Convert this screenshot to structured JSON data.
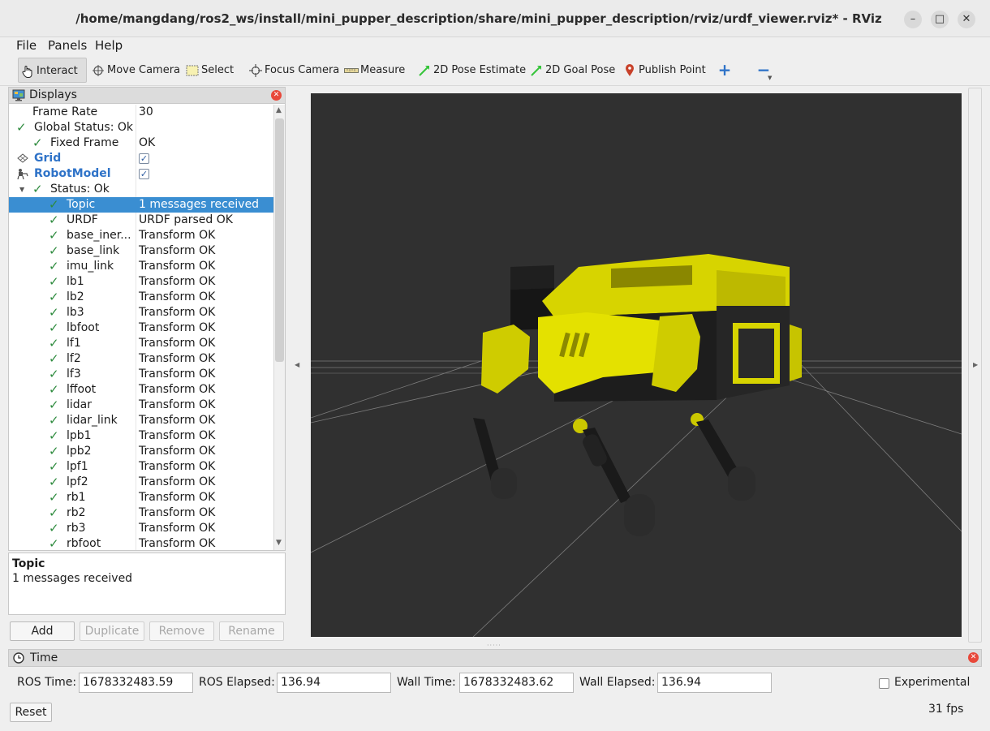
{
  "window": {
    "title": "/home/mangdang/ros2_ws/install/mini_pupper_description/share/mini_pupper_description/rviz/urdf_viewer.rviz* - RViz",
    "minimize": "–",
    "maximize": "□",
    "close": "✕"
  },
  "menu": [
    "File",
    "Panels",
    "Help"
  ],
  "toolbar": {
    "interact": "Interact",
    "move_camera": "Move Camera",
    "select": "Select",
    "focus_camera": "Focus Camera",
    "measure": "Measure",
    "pose_estimate": "2D Pose Estimate",
    "goal_pose": "2D Goal Pose",
    "publish_point": "Publish Point",
    "plus": "+",
    "minus": "−"
  },
  "displays": {
    "title": "Displays",
    "rows": [
      {
        "name": "Frame Rate",
        "value": "30"
      },
      {
        "name": "Global Status: Ok",
        "value": ""
      },
      {
        "name": "Fixed Frame",
        "value": "OK"
      },
      {
        "name": "Grid",
        "value": ""
      },
      {
        "name": "RobotModel",
        "value": ""
      },
      {
        "name": "Status: Ok",
        "value": ""
      },
      {
        "name": "Topic",
        "value": "1 messages received"
      },
      {
        "name": "URDF",
        "value": "URDF parsed OK"
      },
      {
        "name": "base_iner...",
        "value": "Transform OK"
      },
      {
        "name": "base_link",
        "value": "Transform OK"
      },
      {
        "name": "imu_link",
        "value": "Transform OK"
      },
      {
        "name": "lb1",
        "value": "Transform OK"
      },
      {
        "name": "lb2",
        "value": "Transform OK"
      },
      {
        "name": "lb3",
        "value": "Transform OK"
      },
      {
        "name": "lbfoot",
        "value": "Transform OK"
      },
      {
        "name": "lf1",
        "value": "Transform OK"
      },
      {
        "name": "lf2",
        "value": "Transform OK"
      },
      {
        "name": "lf3",
        "value": "Transform OK"
      },
      {
        "name": "lffoot",
        "value": "Transform OK"
      },
      {
        "name": "lidar",
        "value": "Transform OK"
      },
      {
        "name": "lidar_link",
        "value": "Transform OK"
      },
      {
        "name": "lpb1",
        "value": "Transform OK"
      },
      {
        "name": "lpb2",
        "value": "Transform OK"
      },
      {
        "name": "lpf1",
        "value": "Transform OK"
      },
      {
        "name": "lpf2",
        "value": "Transform OK"
      },
      {
        "name": "rb1",
        "value": "Transform OK"
      },
      {
        "name": "rb2",
        "value": "Transform OK"
      },
      {
        "name": "rb3",
        "value": "Transform OK"
      },
      {
        "name": "rbfoot",
        "value": "Transform OK"
      }
    ]
  },
  "description": {
    "title": "Topic",
    "text": "1 messages received"
  },
  "buttons": {
    "add": "Add",
    "duplicate": "Duplicate",
    "remove": "Remove",
    "rename": "Rename"
  },
  "time": {
    "title": "Time",
    "ros_time_label": "ROS Time:",
    "ros_time": "1678332483.59",
    "ros_elapsed_label": "ROS Elapsed:",
    "ros_elapsed": "136.94",
    "wall_time_label": "Wall Time:",
    "wall_time": "1678332483.62",
    "wall_elapsed_label": "Wall Elapsed:",
    "wall_elapsed": "136.94",
    "experimental": "Experimental",
    "reset": "Reset",
    "fps": "31 fps"
  },
  "colors": {
    "selection": "#3a8ed2",
    "robot_body": "#d7d400",
    "viewport_bg": "#303030"
  }
}
